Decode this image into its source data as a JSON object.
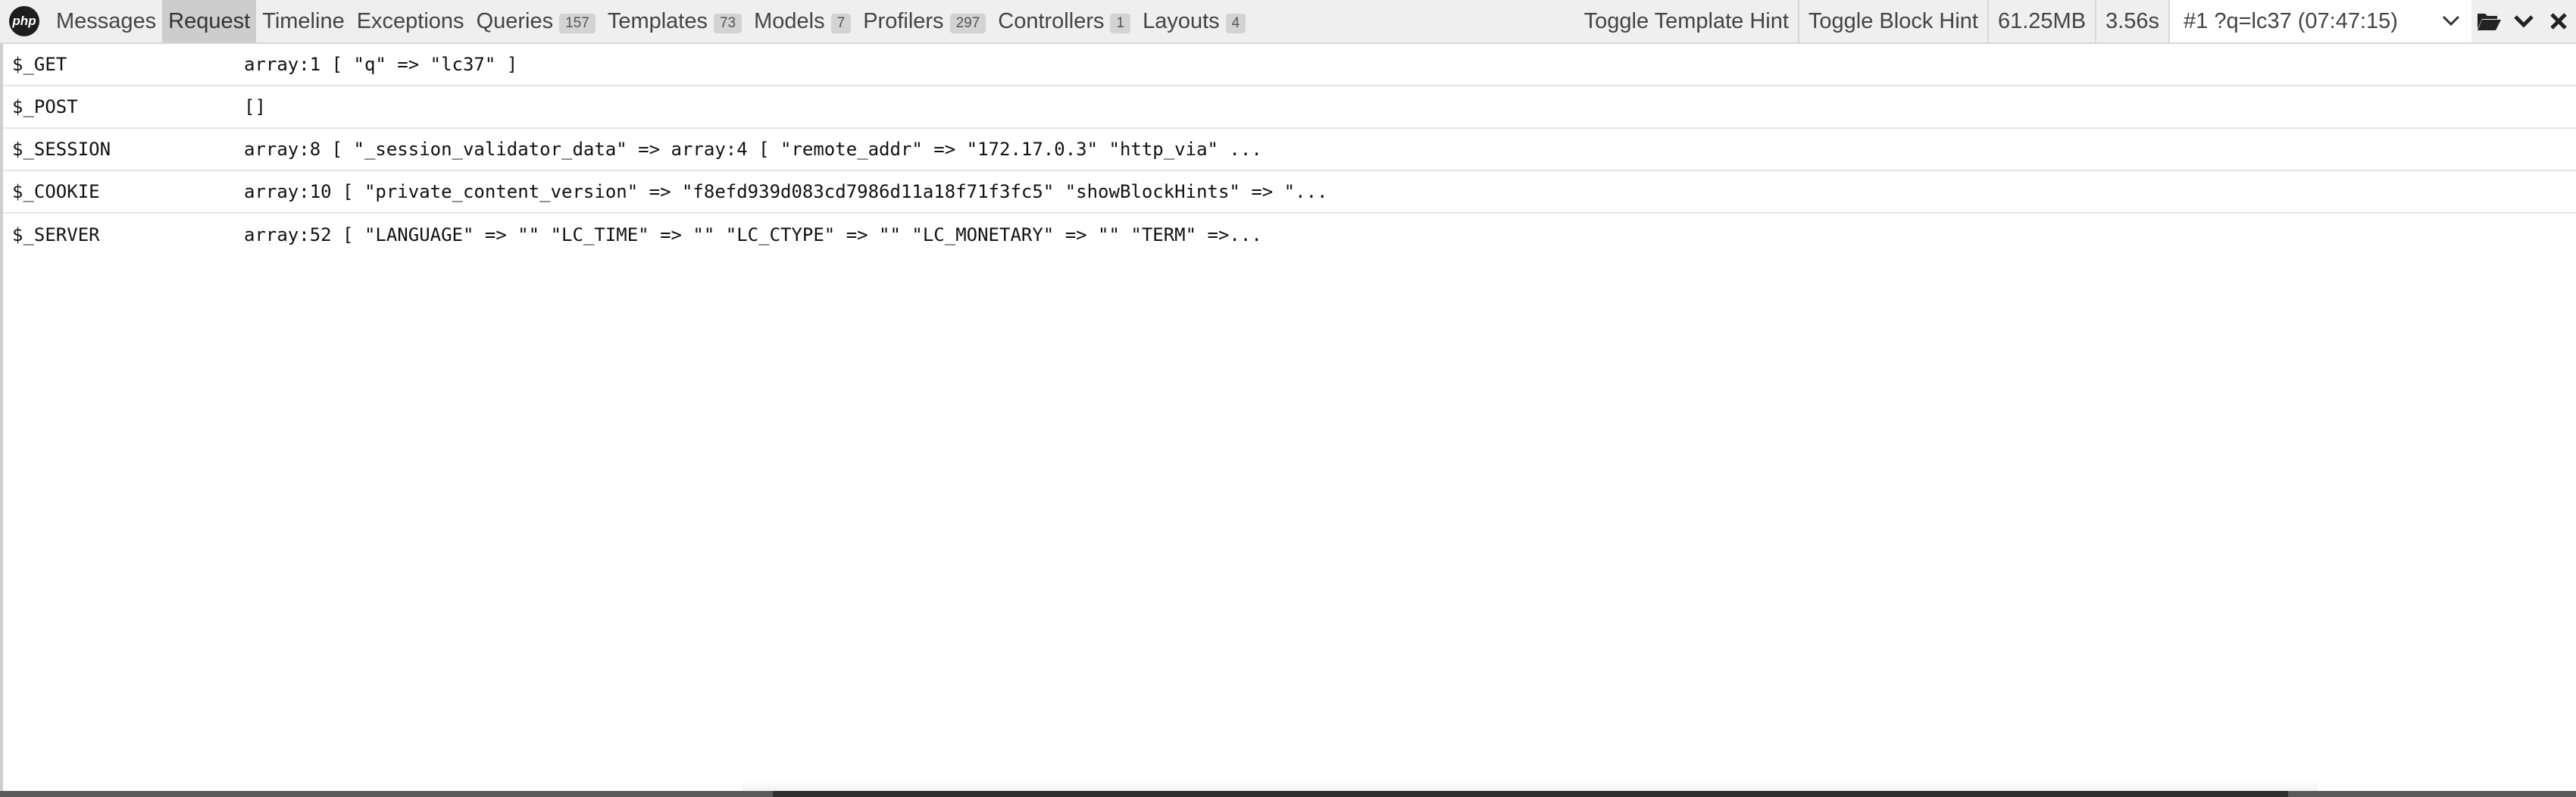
{
  "toolbar": {
    "logo_text": "php",
    "tabs": [
      {
        "label": "Messages",
        "badge": null
      },
      {
        "label": "Request",
        "badge": null,
        "active": true
      },
      {
        "label": "Timeline",
        "badge": null
      },
      {
        "label": "Exceptions",
        "badge": null
      },
      {
        "label": "Queries",
        "badge": "157"
      },
      {
        "label": "Templates",
        "badge": "73"
      },
      {
        "label": "Models",
        "badge": "7"
      },
      {
        "label": "Profilers",
        "badge": "297"
      },
      {
        "label": "Controllers",
        "badge": "1"
      },
      {
        "label": "Layouts",
        "badge": "4"
      }
    ],
    "toggle_template_hint": "Toggle Template Hint",
    "toggle_block_hint": "Toggle Block Hint",
    "memory": "61.25MB",
    "duration": "3.56s",
    "request_select": "#1 ?q=lc37 (07:47:15)",
    "icons": [
      "folder-open-icon",
      "chevron-down-icon",
      "close-icon"
    ]
  },
  "request_vars": [
    {
      "key": "$_GET",
      "value": "array:1 [ \"q\" => \"lc37\" ]"
    },
    {
      "key": "$_POST",
      "value": "[]"
    },
    {
      "key": "$_SESSION",
      "value": "array:8 [ \"_session_validator_data\" => array:4 [ \"remote_addr\" => \"172.17.0.3\" \"http_via\" ..."
    },
    {
      "key": "$_COOKIE",
      "value": "array:10 [ \"private_content_version\" => \"f8efd939d083cd7986d11a18f71f3fc5\" \"showBlockHints\" => \"..."
    },
    {
      "key": "$_SERVER",
      "value": "array:52 [ \"LANGUAGE\" => \"\" \"LC_TIME\" => \"\" \"LC_CTYPE\" => \"\" \"LC_MONETARY\" => \"\" \"TERM\" =>..."
    }
  ]
}
